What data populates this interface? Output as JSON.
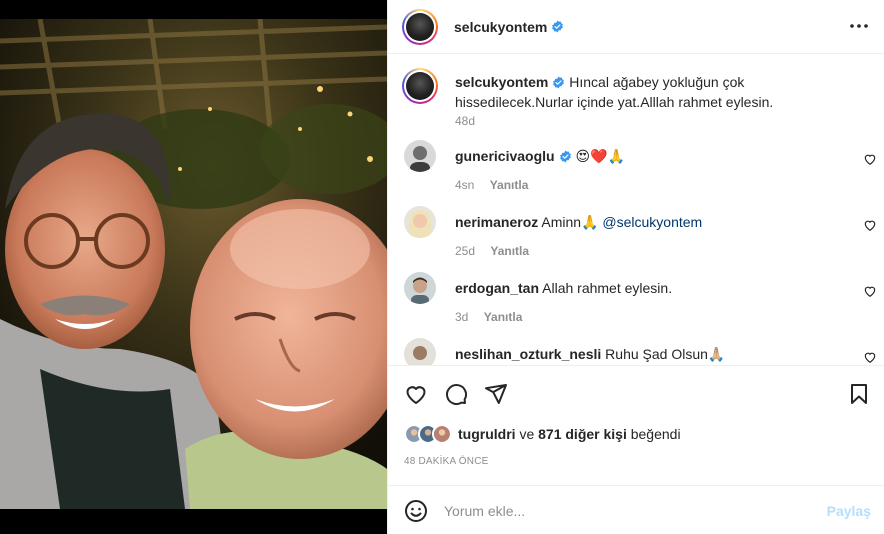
{
  "post": {
    "author": "selcukyontem",
    "author_verified": true
  },
  "header": {
    "username": "selcukyontem",
    "more_icon": "more-horizontal-icon"
  },
  "caption": {
    "username": "selcukyontem",
    "text": "Hıncal ağabey yokluğun çok hissedilecek.Nurlar içinde yat.Alllah rahmet eylesin.",
    "time": "48d"
  },
  "comments": [
    {
      "username": "gunericivaoglu",
      "verified": true,
      "text": "😍❤️🙏",
      "mention": "",
      "time": "4sn",
      "reply": "Yanıtla"
    },
    {
      "username": "nerimaneroz",
      "verified": false,
      "text": "Aminn🙏",
      "mention": "@selcukyontem",
      "time": "25d",
      "reply": "Yanıtla"
    },
    {
      "username": "erdogan_tan",
      "verified": false,
      "text": "Allah rahmet eylesin.",
      "mention": "",
      "time": "3d",
      "reply": "Yanıtla"
    },
    {
      "username": "neslihan_ozturk_nesli",
      "verified": false,
      "text": "Ruhu Şad Olsun🙏🏼",
      "mention": "",
      "time": "",
      "reply": ""
    }
  ],
  "actions": {
    "like_icon": "heart-icon",
    "comment_icon": "comment-icon",
    "share_icon": "paper-plane-icon",
    "save_icon": "bookmark-icon"
  },
  "likes": {
    "first_liker": "tugruldri",
    "connector": "ve",
    "others": "871 diğer kişi",
    "suffix": "beğendi"
  },
  "post_time": "48 DAKİKA ÖNCE",
  "comment_input": {
    "placeholder": "Yorum ekle...",
    "value": "",
    "submit_label": "Paylaş"
  },
  "colors": {
    "verified": "#3897f0",
    "link": "#00376b",
    "muted": "#8e8e8e",
    "share_disabled": "#b2dffc",
    "red_heart": "#ed4956"
  }
}
